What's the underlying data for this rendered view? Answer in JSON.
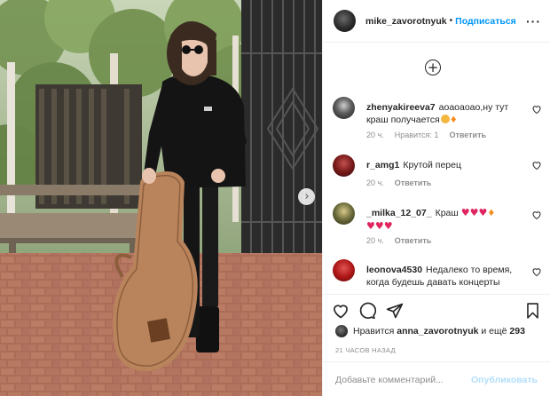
{
  "post": {
    "author": "mike_zavorotnyuk",
    "separator": "•",
    "follow_label": "Подписаться",
    "more_label": "···"
  },
  "comments": [
    {
      "username": "zhenyakireeva7",
      "text": "аоаоаоао,ну тут краш получается",
      "time": "20 ч.",
      "likes": "Нравится: 1",
      "reply": "Ответить"
    },
    {
      "username": "r_amg1",
      "text": "Крутой перец",
      "time": "20 ч.",
      "reply": "Ответить"
    },
    {
      "username": "_milka_12_07_",
      "text": "Краш",
      "time": "20 ч.",
      "reply": "Ответить"
    },
    {
      "username": "leonova4530",
      "text": "Недалеко то время, когда будешь давать концерты"
    }
  ],
  "likes": {
    "prefix": "Нравится",
    "user": "anna_zavorotnyuk",
    "middle": "и ещё",
    "count": "293"
  },
  "timestamp": "21 ЧАСОВ НАЗАД",
  "add_comment": {
    "placeholder": "Добавьте комментарий...",
    "post_label": "Опубликовать"
  },
  "colors": {
    "link": "#0095f6",
    "muted": "#8e8e8e",
    "post_disabled": "#b2dffc",
    "heart": "#e0245e"
  }
}
